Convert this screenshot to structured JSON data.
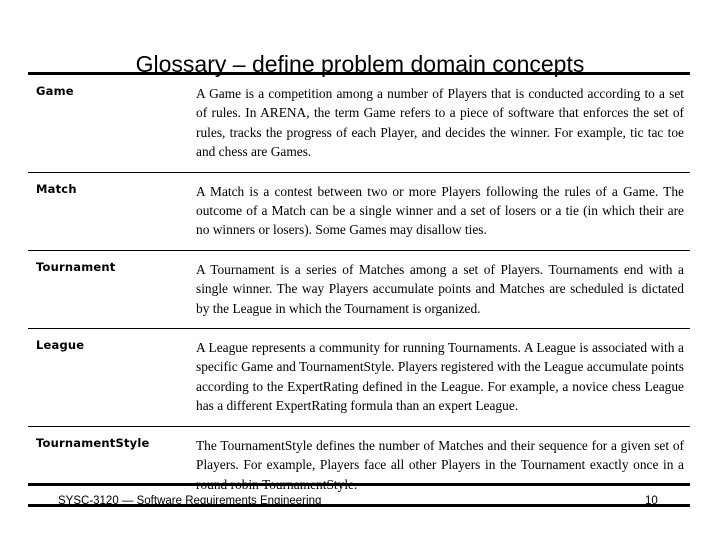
{
  "slide": {
    "title": "Glossary – define problem domain concepts",
    "page_number": "10",
    "footer_text": "SYSC-3120 — Software Requirements Engineering",
    "rule_color": "#000000"
  },
  "glossary": {
    "rows": [
      {
        "term": "Game",
        "definition": "A Game is a competition among a number of Players that is conducted according to a set of rules. In ARENA, the term Game refers to a piece of software that enforces the set of rules, tracks the progress of each Player, and decides the winner. For example, tic tac toe and chess are Games."
      },
      {
        "term": "Match",
        "definition": "A Match is a contest between two or more Players following the rules of a Game. The outcome of a Match can be a single winner and a set of losers or a tie (in which their are no winners or losers). Some Games may disallow ties."
      },
      {
        "term": "Tournament",
        "definition": "A Tournament is a series of Matches among a set of Players. Tournaments end with a single winner. The way Players accumulate points and Matches are scheduled is dictated by the League in which the Tournament is organized."
      },
      {
        "term": "League",
        "definition": "A League represents a community for running Tournaments. A League is associated with a specific Game and TournamentStyle. Players registered with the League accumulate points according to the ExpertRating defined in the League. For example, a novice chess League has a different ExpertRating formula than an expert League."
      },
      {
        "term": "TournamentStyle",
        "definition": "The TournamentStyle defines the number of Matches and their sequence for a given set of Players. For example, Players face all other Players in the Tournament exactly once in a round robin TournamentStyle."
      }
    ]
  }
}
